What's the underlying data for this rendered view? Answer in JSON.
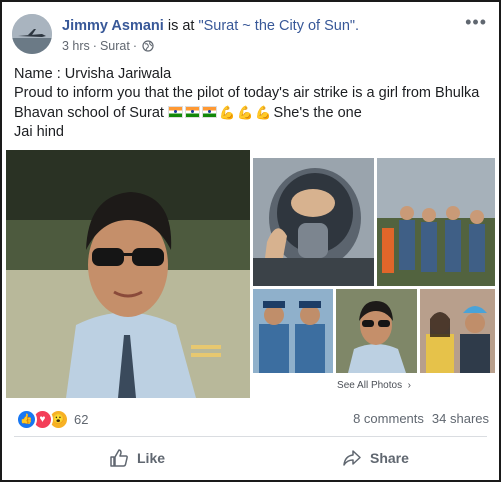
{
  "post": {
    "author": "Jimmy Asmani",
    "connector": "is at",
    "location": "\"Surat ~ the City of Sun\".",
    "time": "3 hrs",
    "separator": "·",
    "place": "Surat",
    "separator2": "·",
    "more_icon": "more-icon",
    "lines": {
      "line1": "Name : Urvisha Jariwala",
      "line2": "Proud to inform you that the pilot of today's air strike is a girl from Bhulka",
      "line3_a": "Bhavan school of Surat",
      "line3_b": "She's the one",
      "line4": "Jai hind"
    },
    "emoji": {
      "flags": 3,
      "arms": 3
    }
  },
  "photos": {
    "see_all": "See All Photos"
  },
  "stats": {
    "reaction_count": "62",
    "comments": "8 comments",
    "shares": "34 shares"
  },
  "actions": {
    "like": "Like",
    "share": "Share"
  },
  "colors": {
    "link": "#385898",
    "text": "#1c1e21",
    "muted": "#606770",
    "like_blue": "#1877f2",
    "love_red": "#f33e58",
    "wow_yellow": "#f7b125"
  }
}
